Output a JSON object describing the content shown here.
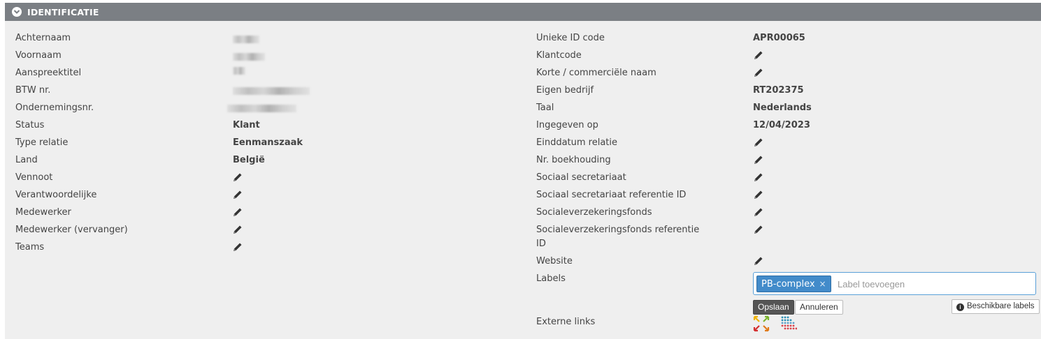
{
  "section": {
    "title": "IDENTIFICATIE",
    "toggle_icon": "chevron-down-circle-icon"
  },
  "left_fields": [
    {
      "label": "Achternaam"
    },
    {
      "label": "Voornaam"
    },
    {
      "label": "Aanspreektitel"
    },
    {
      "label": "BTW nr."
    },
    {
      "label": "Ondernemingsnr."
    },
    {
      "label": "Status",
      "value": "Klant"
    },
    {
      "label": "Type relatie",
      "value": "Eenmanszaak"
    },
    {
      "label": "Land",
      "value": "België"
    },
    {
      "label": "Vennoot"
    },
    {
      "label": "Verantwoordelijke"
    },
    {
      "label": "Medewerker"
    },
    {
      "label": "Medewerker (vervanger)"
    },
    {
      "label": "Teams"
    }
  ],
  "right_fields": [
    {
      "label": "Unieke ID code",
      "value": "APR00065"
    },
    {
      "label": "Klantcode"
    },
    {
      "label": "Korte / commerciële naam"
    },
    {
      "label": "Eigen bedrijf",
      "value": "RT202375"
    },
    {
      "label": "Taal",
      "value": "Nederlands"
    },
    {
      "label": "Ingegeven op",
      "value": "12/04/2023"
    },
    {
      "label": "Einddatum relatie"
    },
    {
      "label": "Nr. boekhouding"
    },
    {
      "label": "Sociaal secretariaat"
    },
    {
      "label": "Sociaal secretariaat referentie ID"
    },
    {
      "label": "Socialeverzekeringsfonds"
    },
    {
      "label": "Socialeverzekeringsfonds referentie",
      "label_line2": "ID"
    },
    {
      "label": "Website"
    },
    {
      "label": "Labels"
    },
    {
      "label": "Externe links"
    }
  ],
  "labels": {
    "tags": [
      "PB-complex"
    ],
    "tag_remove": "×",
    "placeholder": "Label toevoegen",
    "save_label": "Opslaan",
    "cancel_label": "Annuleren",
    "available_label": "Beschikbare labels",
    "info_glyph": "i"
  },
  "external_links": [
    {
      "icon": "arrows-logo-icon"
    },
    {
      "icon": "dots-grid-logo-icon"
    }
  ],
  "colors": {
    "header": "#7b7f84",
    "panel": "#efefef",
    "tag": "#428bca",
    "save_button": "#555555"
  }
}
